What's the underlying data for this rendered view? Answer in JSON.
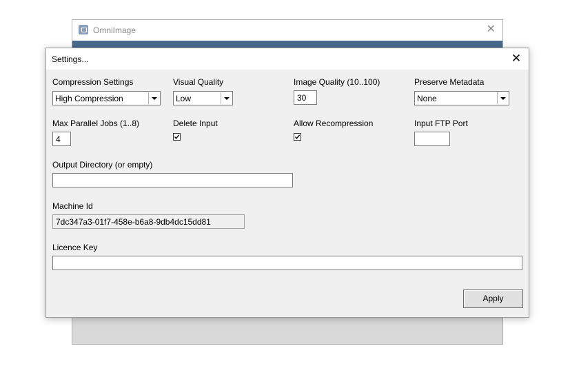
{
  "main_window": {
    "title": "OmniImage"
  },
  "dialog": {
    "title": "Settings...",
    "compression": {
      "label": "Compression Settings",
      "value": "High Compression"
    },
    "visual_quality": {
      "label": "Visual Quality",
      "value": "Low"
    },
    "image_quality": {
      "label": "Image Quality (10..100)",
      "value": "30"
    },
    "preserve_metadata": {
      "label": "Preserve Metadata",
      "value": "None"
    },
    "max_jobs": {
      "label": "Max Parallel Jobs (1..8)",
      "value": "4"
    },
    "delete_input": {
      "label": "Delete Input",
      "checked": true
    },
    "allow_recompression": {
      "label": "Allow Recompression",
      "checked": true
    },
    "ftp_port": {
      "label": "Input FTP Port",
      "value": ""
    },
    "output_dir": {
      "label": "Output Directory (or empty)",
      "value": ""
    },
    "machine_id": {
      "label": "Machine Id",
      "value": "7dc347a3-01f7-458e-b6a8-9db4dc15dd81"
    },
    "licence_key": {
      "label": "Licence Key",
      "value": ""
    },
    "apply_label": "Apply"
  }
}
